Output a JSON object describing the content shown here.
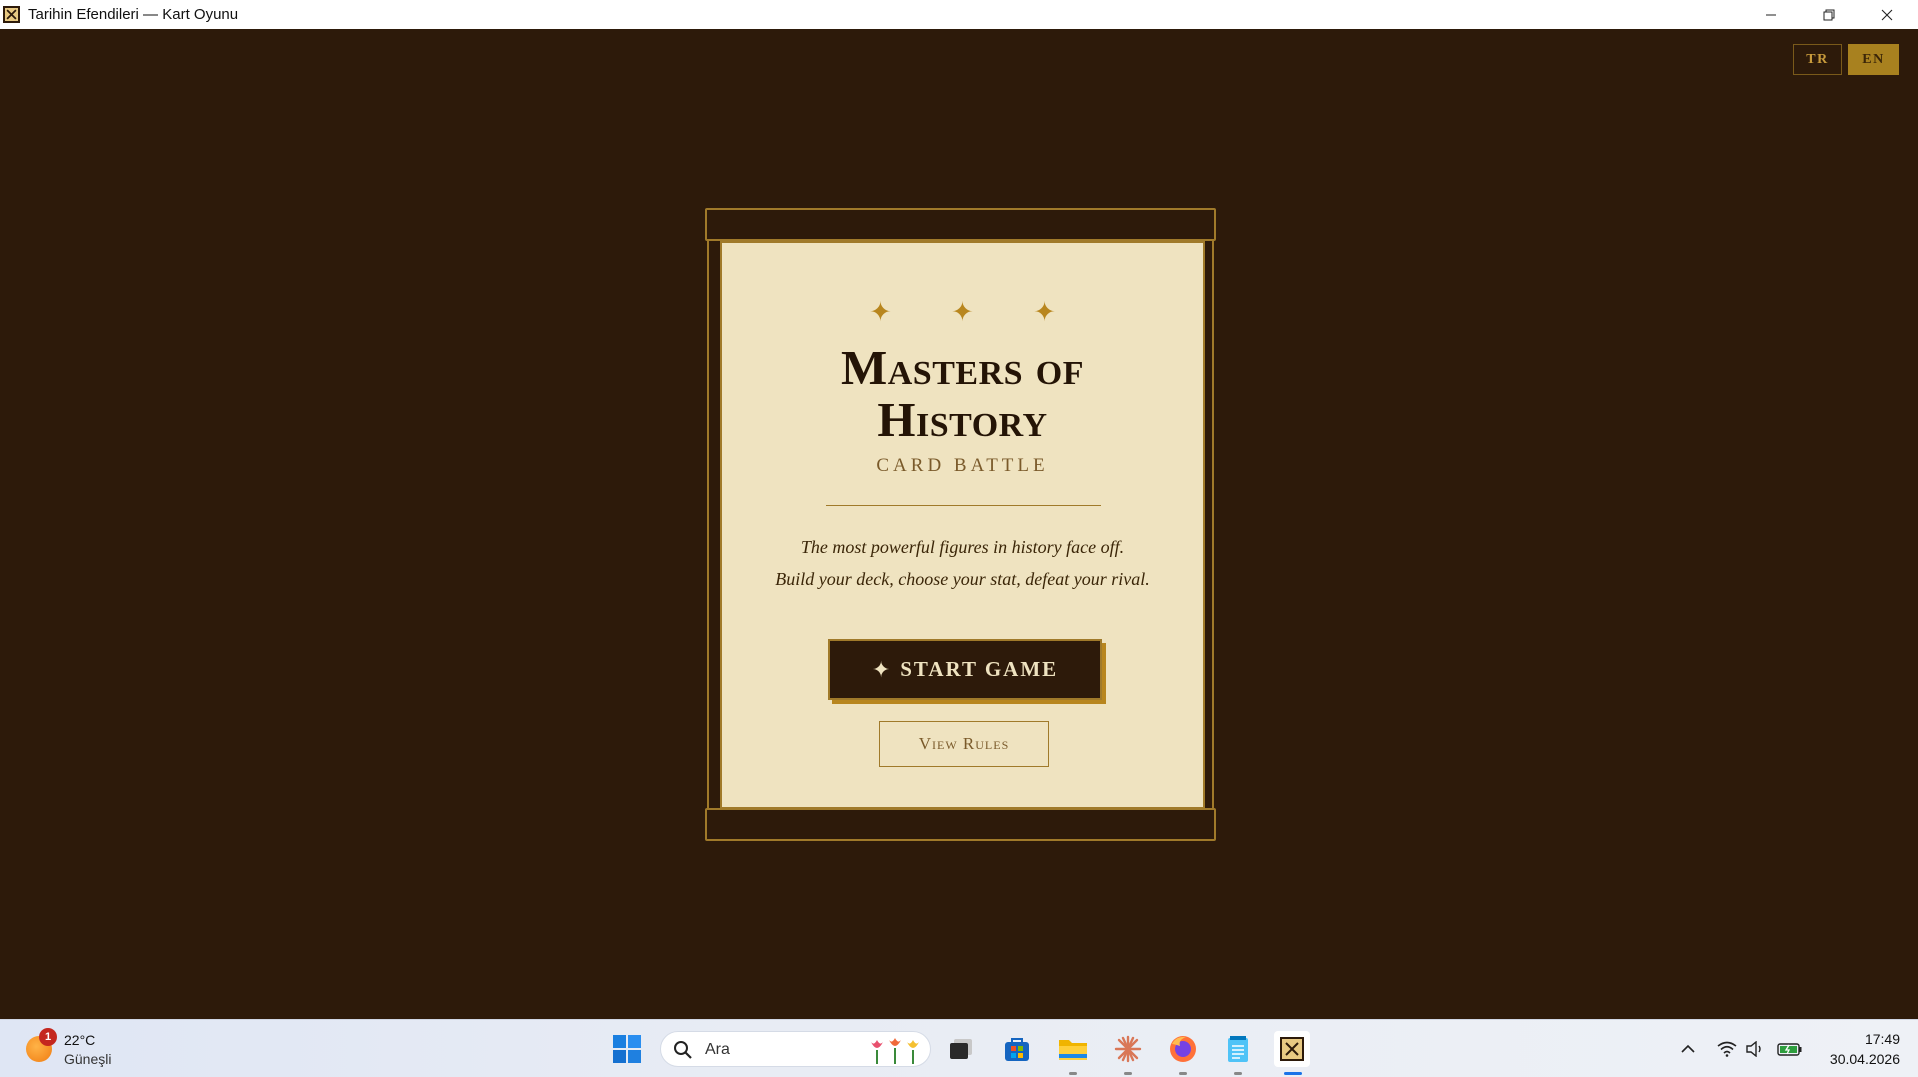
{
  "window": {
    "title": "Tarihin Efendileri — Kart Oyunu"
  },
  "language": {
    "options": [
      "TR",
      "EN"
    ],
    "selected": "EN"
  },
  "game": {
    "stars": "✦ ✦ ✦",
    "title_line1": "Masters of",
    "title_line2": "History",
    "subtitle": "CARD BATTLE",
    "tagline_line1": "The most powerful figures in history face off.",
    "tagline_line2": "Build your deck, choose your stat, defeat your rival.",
    "start_icon": "✦",
    "start_label": "START GAME",
    "rules_label": "View Rules"
  },
  "taskbar": {
    "weather": {
      "badge": "1",
      "temperature": "22°C",
      "condition": "Güneşli"
    },
    "search_placeholder": "Ara",
    "apps": [
      "start-icon",
      "task-view-icon",
      "store-icon",
      "file-explorer-icon",
      "claude-icon",
      "firefox-icon",
      "notepad-icon",
      "card-game-icon"
    ],
    "clock": {
      "time": "17:49",
      "date": "30.04.2026"
    }
  },
  "colors": {
    "background": "#2d1a0a",
    "parchment": "#efe3c0",
    "gold": "#a07a2a",
    "accent": "#b8861e",
    "active_lang_bg": "#a8811f"
  }
}
